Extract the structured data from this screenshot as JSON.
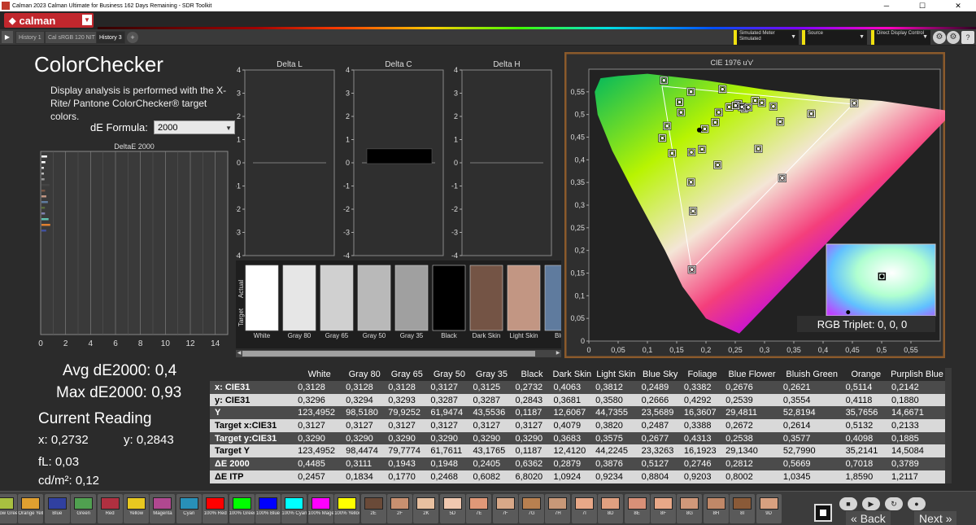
{
  "window": {
    "title": "Calman 2023 Calman Ultimate for Business 162 Days Remaining  -  SDR Toolkit",
    "minimize": "─",
    "maximize": "☐",
    "close": "✕"
  },
  "header": {
    "logo_text": "calman",
    "logo_menu": "▼"
  },
  "tabs": [
    {
      "label": "History 1"
    },
    {
      "label": "Cal sRGB 120 NIT"
    },
    {
      "label": "History 3"
    }
  ],
  "tab_add": "+",
  "devices": {
    "meter": {
      "label": "Simulated Meter",
      "value": "Simulated"
    },
    "source": {
      "label": "Source"
    },
    "display": {
      "label": "Direct Display Control"
    }
  },
  "help": "?",
  "page": {
    "title": "ColorChecker",
    "description": "Display analysis is performed with the X-Rite/ Pantone ColorChecker® target colors.",
    "formula_label": "dE Formula:",
    "formula_value": "2000",
    "avg": "Avg dE2000: 0,4",
    "max": "Max dE2000: 0,93",
    "reading_title": "Current Reading",
    "x": "x: 0,2732",
    "y": "y: 0,2843",
    "fl": "fL: 0,03",
    "cdm2": "cd/m²: 0,12"
  },
  "de_chart": {
    "title": "DeltaE 2000",
    "ticks": [
      "0",
      "2",
      "4",
      "6",
      "8",
      "10",
      "12",
      "14"
    ],
    "xlim": [
      0,
      15
    ]
  },
  "delta_charts": [
    {
      "title": "Delta L",
      "value": 0.0
    },
    {
      "title": "Delta C",
      "value": 0.3
    },
    {
      "title": "Delta H",
      "value": 0.0
    }
  ],
  "delta_ticks": [
    "4",
    "3",
    "2",
    "1",
    "0",
    "-1",
    "-2",
    "-3",
    "-4"
  ],
  "swatch_labels": {
    "actual": "Actual",
    "target": "Target"
  },
  "swatches": [
    {
      "name": "White",
      "color": "#ffffff"
    },
    {
      "name": "Gray 80",
      "color": "#e6e6e6"
    },
    {
      "name": "Gray 65",
      "color": "#d0d0d0"
    },
    {
      "name": "Gray 50",
      "color": "#b9b9b9"
    },
    {
      "name": "Gray 35",
      "color": "#a0a0a0"
    },
    {
      "name": "Black",
      "color": "#000000"
    },
    {
      "name": "Dark Skin",
      "color": "#745445"
    },
    {
      "name": "Light Skin",
      "color": "#c29683"
    },
    {
      "name": "Blue",
      "color": "#5f7b9e"
    }
  ],
  "cie": {
    "title": "CIE 1976 u'v'",
    "xticks": [
      "0",
      "0,05",
      "0,1",
      "0,15",
      "0,2",
      "0,25",
      "0,3",
      "0,35",
      "0,4",
      "0,45",
      "0,5",
      "0,55"
    ],
    "yticks": [
      "0",
      "0,05",
      "0,1",
      "0,15",
      "0,2",
      "0,25",
      "0,3",
      "0,35",
      "0,4",
      "0,45",
      "0,5",
      "0,55"
    ],
    "triplet": "RGB Triplet: 0, 0, 0",
    "gamut": {
      "red": [
        0.451,
        0.523
      ],
      "green": [
        0.125,
        0.5625
      ],
      "blue": [
        0.1754,
        0.1579
      ]
    },
    "current_point": [
      0.1888,
      0.4658
    ],
    "targets": [
      [
        0.1978,
        0.4683
      ],
      [
        0.2158,
        0.4828
      ],
      [
        0.2218,
        0.5048
      ],
      [
        0.2552,
        0.5233
      ],
      [
        0.2398,
        0.5165
      ],
      [
        0.2655,
        0.5128
      ],
      [
        0.2841,
        0.5307
      ],
      [
        0.2955,
        0.5259
      ],
      [
        0.3151,
        0.5178
      ],
      [
        0.2614,
        0.5169
      ],
      [
        0.2505,
        0.5197
      ],
      [
        0.2723,
        0.5158
      ],
      [
        0.1549,
        0.5274
      ],
      [
        0.1574,
        0.5046
      ],
      [
        0.1336,
        0.4746
      ],
      [
        0.1255,
        0.4479
      ],
      [
        0.1422,
        0.4146
      ],
      [
        0.1751,
        0.4167
      ],
      [
        0.1744,
        0.3507
      ],
      [
        0.1779,
        0.2868
      ],
      [
        0.2199,
        0.3887
      ],
      [
        0.2894,
        0.4243
      ],
      [
        0.3303,
        0.3596
      ],
      [
        0.3799,
        0.5016
      ],
      [
        0.4532,
        0.5248
      ],
      [
        0.3267,
        0.4843
      ],
      [
        0.2281,
        0.5557
      ],
      [
        0.1745,
        0.5502
      ],
      [
        0.1933,
        0.4232
      ],
      [
        0.1282,
        0.5752
      ],
      [
        0.1761,
        0.1578
      ]
    ],
    "inset_points": [
      [
        0.2,
        0.19
      ],
      [
        0.51,
        0.45
      ]
    ]
  },
  "table": {
    "columns": [
      "White",
      "Gray 80",
      "Gray 65",
      "Gray 50",
      "Gray 35",
      "Black",
      "Dark Skin",
      "Light Skin",
      "Blue Sky",
      "Foliage",
      "Blue Flower",
      "Bluish Green",
      "Orange",
      "Purplish Blue"
    ],
    "rows": [
      {
        "label": "x: CIE31",
        "values": [
          "0,3128",
          "0,3128",
          "0,3128",
          "0,3127",
          "0,3125",
          "0,2732",
          "0,4063",
          "0,3812",
          "0,2489",
          "0,3382",
          "0,2676",
          "0,2621",
          "0,5114",
          "0,2142"
        ]
      },
      {
        "label": "y: CIE31",
        "values": [
          "0,3296",
          "0,3294",
          "0,3293",
          "0,3287",
          "0,3287",
          "0,2843",
          "0,3681",
          "0,3580",
          "0,2666",
          "0,4292",
          "0,2539",
          "0,3554",
          "0,4118",
          "0,1880"
        ]
      },
      {
        "label": "Y",
        "values": [
          "123,4952",
          "98,5180",
          "79,9252",
          "61,9474",
          "43,5536",
          "0,1187",
          "12,6067",
          "44,7355",
          "23,5689",
          "16,3607",
          "29,4811",
          "52,8194",
          "35,7656",
          "14,6671"
        ]
      },
      {
        "label": "Target x:CIE31",
        "values": [
          "0,3127",
          "0,3127",
          "0,3127",
          "0,3127",
          "0,3127",
          "0,3127",
          "0,4079",
          "0,3820",
          "0,2487",
          "0,3388",
          "0,2672",
          "0,2614",
          "0,5132",
          "0,2133"
        ]
      },
      {
        "label": "Target y:CIE31",
        "values": [
          "0,3290",
          "0,3290",
          "0,3290",
          "0,3290",
          "0,3290",
          "0,3290",
          "0,3683",
          "0,3575",
          "0,2677",
          "0,4313",
          "0,2538",
          "0,3577",
          "0,4098",
          "0,1885"
        ]
      },
      {
        "label": "Target Y",
        "values": [
          "123,4952",
          "98,4474",
          "79,7774",
          "61,7611",
          "43,1765",
          "0,1187",
          "12,4120",
          "44,2245",
          "23,3263",
          "16,1923",
          "29,1340",
          "52,7990",
          "35,2141",
          "14,5084"
        ]
      },
      {
        "label": "ΔE 2000",
        "values": [
          "0,4485",
          "0,3111",
          "0,1943",
          "0,1948",
          "0,2405",
          "0,6362",
          "0,2879",
          "0,3876",
          "0,5127",
          "0,2746",
          "0,2812",
          "0,5669",
          "0,7018",
          "0,3789"
        ]
      },
      {
        "label": "ΔE ITP",
        "values": [
          "0,2457",
          "0,1834",
          "0,1770",
          "0,2468",
          "0,6082",
          "6,8020",
          "1,0924",
          "0,9234",
          "0,8804",
          "0,9203",
          "0,8002",
          "1,0345",
          "1,8590",
          "1,2117"
        ]
      }
    ]
  },
  "patches": [
    {
      "label": "Yellow Green",
      "color": "#a8c040"
    },
    {
      "label": "Orange Yellow",
      "color": "#e0a030"
    },
    {
      "label": "Blue",
      "color": "#3040a0"
    },
    {
      "label": "Green",
      "color": "#50a050"
    },
    {
      "label": "Red",
      "color": "#b03040"
    },
    {
      "label": "Yellow",
      "color": "#e8c820"
    },
    {
      "label": "Magenta",
      "color": "#b04890"
    },
    {
      "label": "Cyan",
      "color": "#2890b8"
    },
    {
      "label": "100% Red",
      "color": "#ff0000"
    },
    {
      "label": "100% Green",
      "color": "#00ff00"
    },
    {
      "label": "100% Blue",
      "color": "#0000ff"
    },
    {
      "label": "100% Cyan",
      "color": "#00ffff"
    },
    {
      "label": "100% Magenta",
      "color": "#ff00ff"
    },
    {
      "label": "100% Yellow",
      "color": "#ffff00"
    },
    {
      "label": "2E",
      "color": "#6a4a38"
    },
    {
      "label": "2F",
      "color": "#c89070"
    },
    {
      "label": "2K",
      "color": "#e8c0a0"
    },
    {
      "label": "5D",
      "color": "#f0c8b0"
    },
    {
      "label": "7E",
      "color": "#e09878"
    },
    {
      "label": "7F",
      "color": "#d8a888"
    },
    {
      "label": "7G",
      "color": "#b88050"
    },
    {
      "label": "7H",
      "color": "#c89878"
    },
    {
      "label": "7I",
      "color": "#e8a888"
    },
    {
      "label": "8D",
      "color": "#e0a080"
    },
    {
      "label": "8E",
      "color": "#d89078"
    },
    {
      "label": "8F",
      "color": "#e8a888"
    },
    {
      "label": "8G",
      "color": "#d0987a"
    },
    {
      "label": "8H",
      "color": "#c08868"
    },
    {
      "label": "8I",
      "color": "#8a5a38"
    },
    {
      "label": "9D",
      "color": "#d8a080"
    }
  ],
  "controls": {
    "back": "Back",
    "next": "Next"
  }
}
